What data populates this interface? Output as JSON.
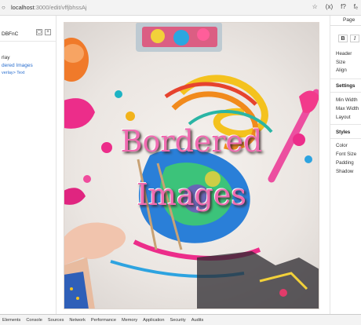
{
  "browser": {
    "nav_glyph": "○",
    "url_host": "localhost",
    "url_path": ":3000/edit/vffjbhssAj",
    "icons": [
      "star-icon",
      "formula-icon",
      "function-icon",
      "text-icon"
    ],
    "icon_glyphs": [
      "☆",
      "(x)",
      "f?",
      "fₑ"
    ]
  },
  "left_panel": {
    "doc_id": "DBFnC",
    "add_label": "+",
    "box_label": "▢",
    "tree": [
      "rlay",
      "dered Images",
      "verlay> Text"
    ]
  },
  "canvas": {
    "overlay_line1": "Bordered",
    "overlay_line2": "Images"
  },
  "right_panel": {
    "tab": "Page",
    "format_buttons": [
      "B",
      "I",
      "I"
    ],
    "items_top": [
      "Header",
      "Size",
      "Align"
    ],
    "section_settings": "Settings",
    "items_settings": [
      "Min Width",
      "Max Width",
      "Layout"
    ],
    "section_styles": "Styles",
    "items_styles": [
      "Color",
      "Font Size",
      "Padding",
      "Shadow"
    ]
  },
  "devtools": {
    "tabs": [
      "Elements",
      "Console",
      "Sources",
      "Network",
      "Performance",
      "Memory",
      "Application",
      "Security",
      "Audits"
    ]
  }
}
